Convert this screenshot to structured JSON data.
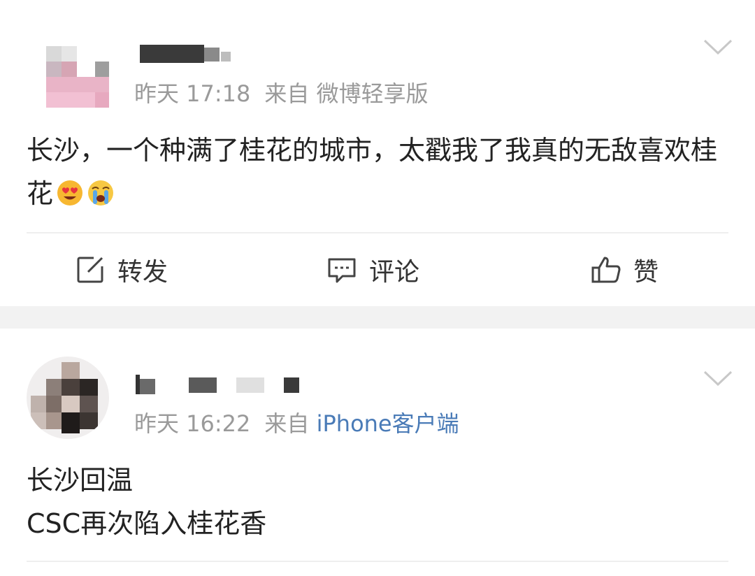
{
  "feed": {
    "posts": [
      {
        "time": "昨天 17:18",
        "source_prefix": "来自",
        "source": "微博轻享版",
        "text": "长沙，一个种满了桂花的城市，太戳我了我真的无敌喜欢桂花",
        "emojis": [
          "heart-eyes-emoji",
          "crying-emoji"
        ],
        "actions": {
          "repost": "转发",
          "comment": "评论",
          "like": "赞"
        }
      },
      {
        "time": "昨天 16:22",
        "source_prefix": "来自",
        "source": "iPhone客户端",
        "text": "长沙回温\nCSC再次陷入桂花香"
      }
    ]
  },
  "colors": {
    "meta_gray": "#9a9a9a",
    "source_link_blue": "#4a7bb7",
    "separator_band": "#f2f2f2",
    "divider": "#eeeeee"
  }
}
